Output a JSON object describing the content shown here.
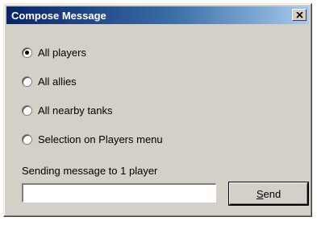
{
  "window": {
    "title": "Compose Message",
    "close_symbol": "x"
  },
  "recipients": {
    "selected": "All players",
    "options": [
      {
        "label": "All players",
        "checked": true
      },
      {
        "label": "All allies",
        "checked": false
      },
      {
        "label": "All nearby tanks",
        "checked": false
      },
      {
        "label": "Selection on Players menu",
        "checked": false
      }
    ]
  },
  "status_text": "Sending message to 1 player",
  "message_input": {
    "value": "",
    "placeholder": ""
  },
  "send_button": {
    "mnemonic": "S",
    "rest": "end"
  },
  "colors": {
    "dialog_bg": "#d4d0c8",
    "title_start": "#0a246a",
    "title_end": "#a6caf0",
    "title_text": "#ffffff"
  },
  "icons": {
    "close": "close-icon",
    "radio_selected": "radio-selected-icon",
    "radio_unselected": "radio-unselected-icon"
  }
}
